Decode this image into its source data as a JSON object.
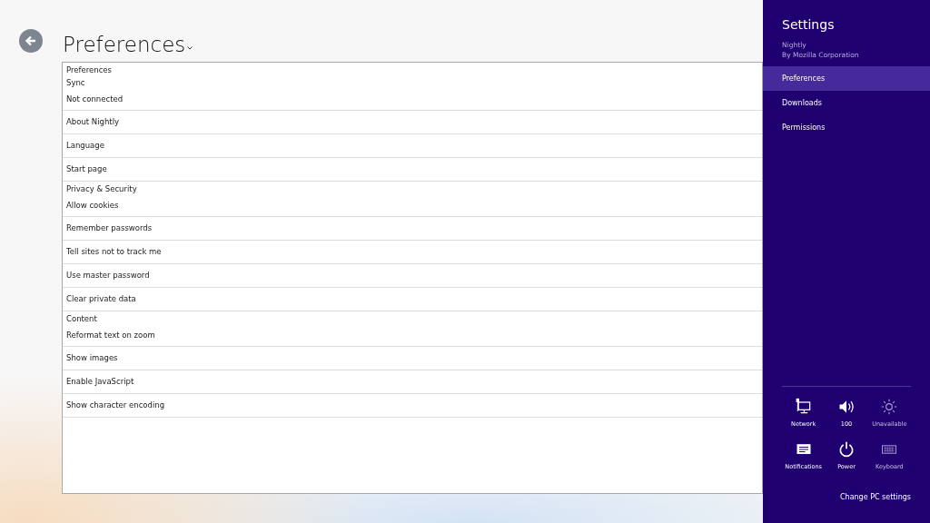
{
  "page": {
    "title": "Preferences",
    "caption": "Preferences"
  },
  "sections": [
    {
      "heading": "Sync",
      "items": [
        "Not connected",
        "About Nightly",
        "Language",
        "Start page"
      ]
    },
    {
      "heading": "Privacy & Security",
      "items": [
        "Allow cookies",
        "Remember passwords",
        "Tell sites not to track me",
        "Use master password",
        "Clear private data"
      ]
    },
    {
      "heading": "Content",
      "items": [
        "Reformat text on zoom",
        "Show images",
        "Enable JavaScript",
        "Show character encoding"
      ]
    }
  ],
  "settings_pane": {
    "title": "Settings",
    "app_name": "Nightly",
    "publisher": "By Mozilla Corporation",
    "items": [
      {
        "label": "Preferences",
        "selected": true
      },
      {
        "label": "Downloads",
        "selected": false
      },
      {
        "label": "Permissions",
        "selected": false
      }
    ],
    "quick_settings": [
      {
        "kind": "network",
        "label": "Network",
        "disabled": false
      },
      {
        "kind": "volume",
        "label": "100",
        "disabled": false
      },
      {
        "kind": "brightness",
        "label": "Unavailable",
        "disabled": true
      },
      {
        "kind": "notifications",
        "label": "Notifications",
        "disabled": false
      },
      {
        "kind": "power",
        "label": "Power",
        "disabled": false
      },
      {
        "kind": "keyboard",
        "label": "Keyboard",
        "disabled": true
      }
    ],
    "footer_link": "Change PC settings"
  }
}
